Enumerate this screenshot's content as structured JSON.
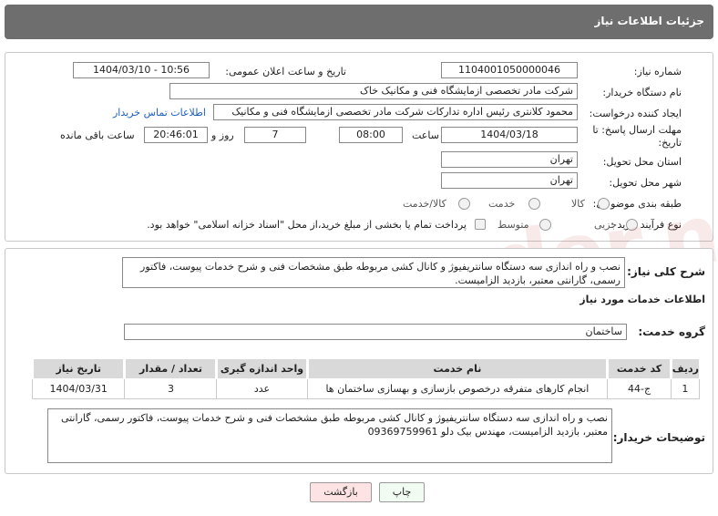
{
  "header": {
    "title": "جزئیات اطلاعات نیاز"
  },
  "form": {
    "need_number_label": "شماره نیاز:",
    "need_number": "1104001050000046",
    "announce_label": "تاریخ و ساعت اعلان عمومی:",
    "announce_value": "1404/03/10 - 10:56",
    "buyer_org_label": "نام دستگاه خریدار:",
    "buyer_org": "شرکت مادر تخصصی ازمایشگاه فنی و مکانیک خاک",
    "requester_label": "ایجاد کننده درخواست:",
    "requester": "محمود کلانتری رئیس اداره تدارکات شرکت مادر تخصصی ازمایشگاه فنی و مکانیک",
    "contact_link": "اطلاعات تماس خریدار",
    "deadline_label_1": "مهلت ارسال پاسخ: تا",
    "deadline_label_2": "تاریخ:",
    "deadline_date": "1404/03/18",
    "time_label": "ساعت",
    "deadline_time": "08:00",
    "days_value": "7",
    "days_label": "روز و",
    "remaining_time": "20:46:01",
    "remaining_label": "ساعت باقی مانده",
    "province_label": "استان محل تحویل:",
    "province": "تهران",
    "city_label": "شهر محل تحویل:",
    "city": "تهران",
    "category_label": "طبقه بندی موضوعی:",
    "category_options": [
      "کالا",
      "خدمت",
      "کالا/خدمت"
    ],
    "process_label": "نوع فرآیند خرید :",
    "process_options": [
      "جزیی",
      "متوسط"
    ],
    "payment_note": "پرداخت تمام یا بخشی از مبلغ خرید،از محل \"اسناد خزانه اسلامی\" خواهد بود."
  },
  "summary": {
    "label": "شرح کلی نیاز:",
    "text": "نصب و راه اندازی سه دستگاه سانتریفیوژ و کانال کشی مربوطه طبق مشخصات فنی و شرح خدمات پیوست، فاکتور رسمی، گارانتی معتبر، بازدید الزامیست."
  },
  "services": {
    "section_title": "اطلاعات خدمات مورد نیاز",
    "group_label": "گروه خدمت:",
    "group_value": "ساختمان",
    "columns": [
      "ردیف",
      "کد خدمت",
      "نام خدمت",
      "واحد اندازه گیری",
      "تعداد / مقدار",
      "تاریخ نیاز"
    ],
    "rows": [
      [
        "1",
        "ج-44",
        "انجام کارهای متفرقه درخصوص بازسازی و بهسازی ساختمان ها",
        "عدد",
        "3",
        "1404/03/31"
      ]
    ]
  },
  "buyer_notes": {
    "label": "توضیحات خریدار:",
    "text": "نصب و راه اندازی سه دستگاه سانتریفیوژ و کانال کشی مربوطه طبق مشخصات فنی و شرح خدمات پیوست، فاکتور رسمی، گارانتی معتبر، بازدید الزامیست، مهندس بیک دلو 09369759961"
  },
  "buttons": {
    "print": "چاپ",
    "back": "بازگشت"
  },
  "colors": {
    "header_bg": "#6e6e6e",
    "link": "#1f5fbf",
    "back_btn": "#fde3e3",
    "print_btn": "#f2fbf2"
  }
}
